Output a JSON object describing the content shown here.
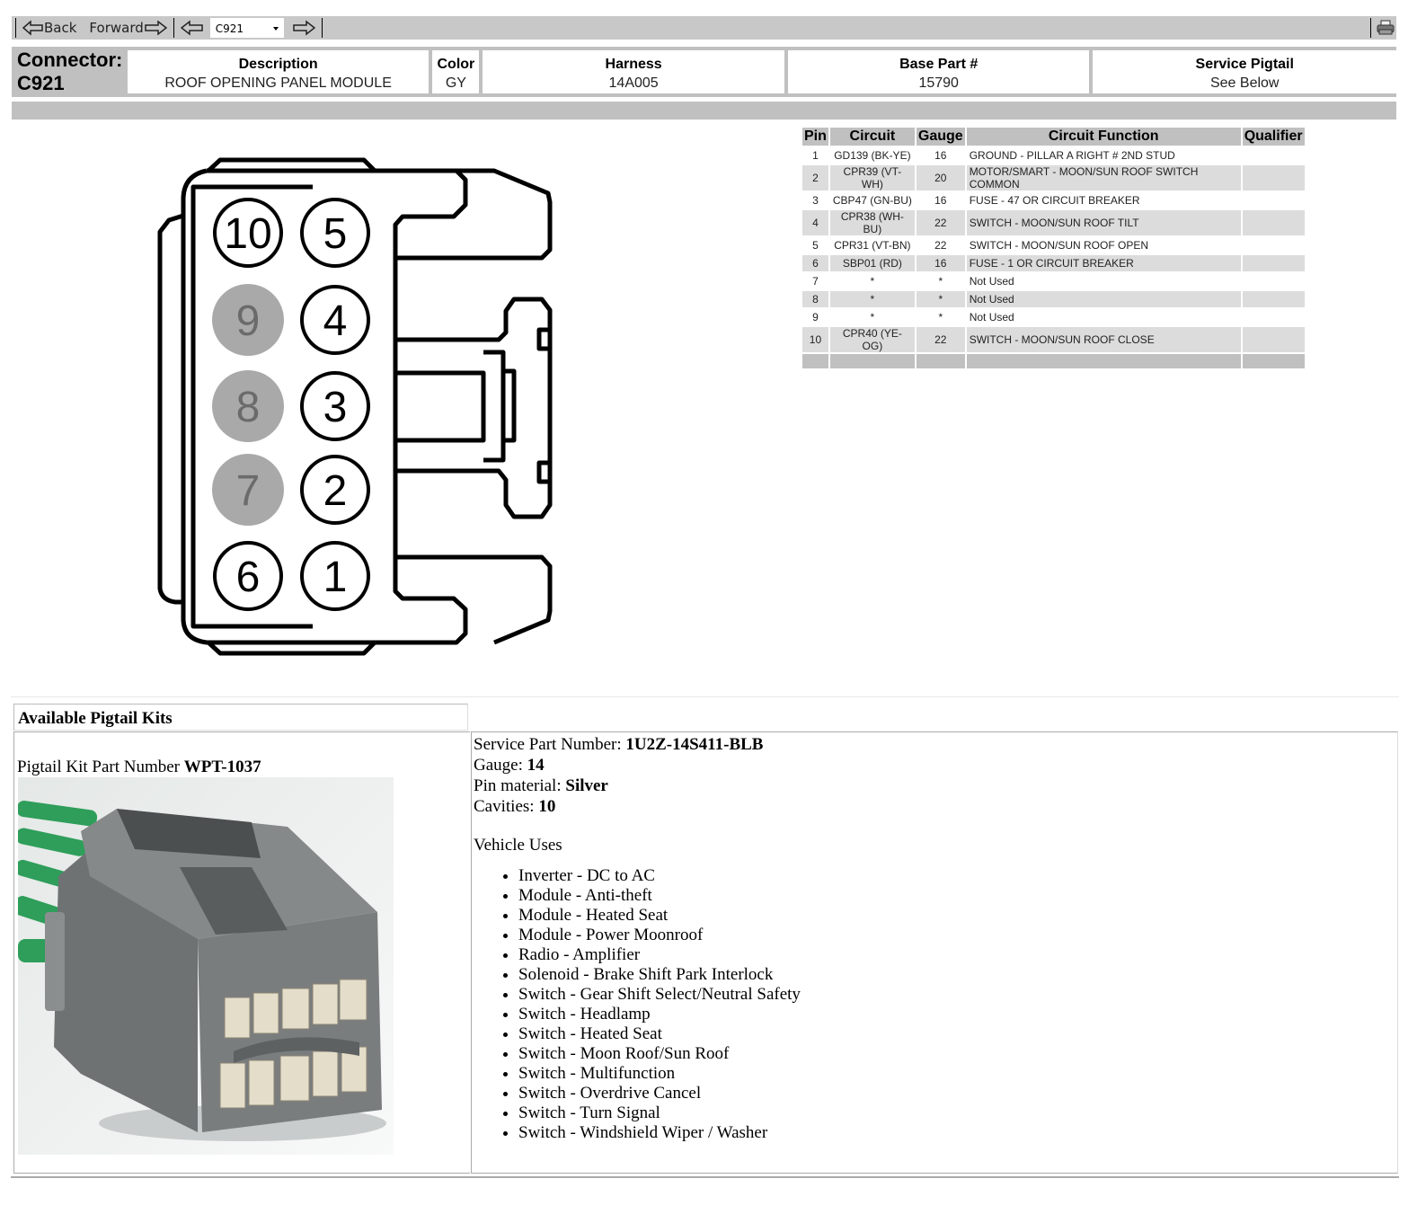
{
  "toolbar": {
    "back_label": "Back",
    "forward_label": "Forward",
    "connector_select_value": "C921",
    "icons": {
      "back": "arrow-left-icon",
      "forward": "arrow-right-icon",
      "prev": "arrow-left-icon",
      "next": "arrow-right-icon",
      "print": "printer-icon"
    }
  },
  "connector": {
    "label": "Connector:",
    "id": "C921",
    "fields": [
      {
        "header": "Description",
        "value": "ROOF OPENING PANEL MODULE"
      },
      {
        "header": "Color",
        "value": "GY"
      },
      {
        "header": "Harness",
        "value": "14A005"
      },
      {
        "header": "Base Part #",
        "value": "15790"
      },
      {
        "header": "Service Pigtail",
        "value": "See Below"
      }
    ]
  },
  "diagram": {
    "pins": [
      {
        "number": "10",
        "used": true
      },
      {
        "number": "5",
        "used": true
      },
      {
        "number": "9",
        "used": false
      },
      {
        "number": "4",
        "used": true
      },
      {
        "number": "8",
        "used": false
      },
      {
        "number": "3",
        "used": true
      },
      {
        "number": "7",
        "used": false
      },
      {
        "number": "2",
        "used": true
      },
      {
        "number": "6",
        "used": true
      },
      {
        "number": "1",
        "used": true
      }
    ],
    "colors": {
      "unused_fill": "#a9a9a9",
      "unused_text": "#6b6b6b",
      "stroke": "#000000"
    }
  },
  "pin_table": {
    "headers": [
      "Pin",
      "Circuit",
      "Gauge",
      "Circuit Function",
      "Qualifier"
    ],
    "rows": [
      [
        "1",
        "GD139 (BK-YE)",
        "16",
        "GROUND - PILLAR A RIGHT # 2ND STUD",
        ""
      ],
      [
        "2",
        "CPR39 (VT-WH)",
        "20",
        "MOTOR/SMART - MOON/SUN ROOF SWITCH COMMON",
        ""
      ],
      [
        "3",
        "CBP47 (GN-BU)",
        "16",
        "FUSE - 47 OR CIRCUIT BREAKER",
        ""
      ],
      [
        "4",
        "CPR38 (WH-BU)",
        "22",
        "SWITCH - MOON/SUN ROOF TILT",
        ""
      ],
      [
        "5",
        "CPR31 (VT-BN)",
        "22",
        "SWITCH - MOON/SUN ROOF OPEN",
        ""
      ],
      [
        "6",
        "SBP01 (RD)",
        "16",
        "FUSE - 1 OR CIRCUIT BREAKER",
        ""
      ],
      [
        "7",
        "*",
        "*",
        "Not Used",
        ""
      ],
      [
        "8",
        "*",
        "*",
        "Not Used",
        ""
      ],
      [
        "9",
        "*",
        "*",
        "Not Used",
        ""
      ],
      [
        "10",
        "CPR40 (YE-OG)",
        "22",
        "SWITCH - MOON/SUN ROOF CLOSE",
        ""
      ]
    ]
  },
  "pigtail": {
    "section_title": "Available Pigtail Kits",
    "kit_label": "Pigtail Kit Part Number",
    "kit_number": "WPT-1037",
    "photo_alt": "connector-photo",
    "specs": [
      {
        "label": "Service Part Number:",
        "value": "1U2Z-14S411-BLB"
      },
      {
        "label": "Gauge:",
        "value": "14"
      },
      {
        "label": "Pin material:",
        "value": "Silver"
      },
      {
        "label": "Cavities:",
        "value": "10"
      }
    ],
    "vehicle_uses_title": "Vehicle Uses",
    "vehicle_uses": [
      "Inverter - DC to AC",
      "Module - Anti-theft",
      "Module - Heated Seat",
      "Module - Power Moonroof",
      "Radio - Amplifier",
      "Solenoid - Brake Shift Park Interlock",
      "Switch - Gear Shift Select/Neutral Safety",
      "Switch - Headlamp",
      "Switch - Heated Seat",
      "Switch - Moon Roof/Sun Roof",
      "Switch - Multifunction",
      "Switch - Overdrive Cancel",
      "Switch - Turn Signal",
      "Switch - Windshield Wiper / Washer"
    ]
  }
}
